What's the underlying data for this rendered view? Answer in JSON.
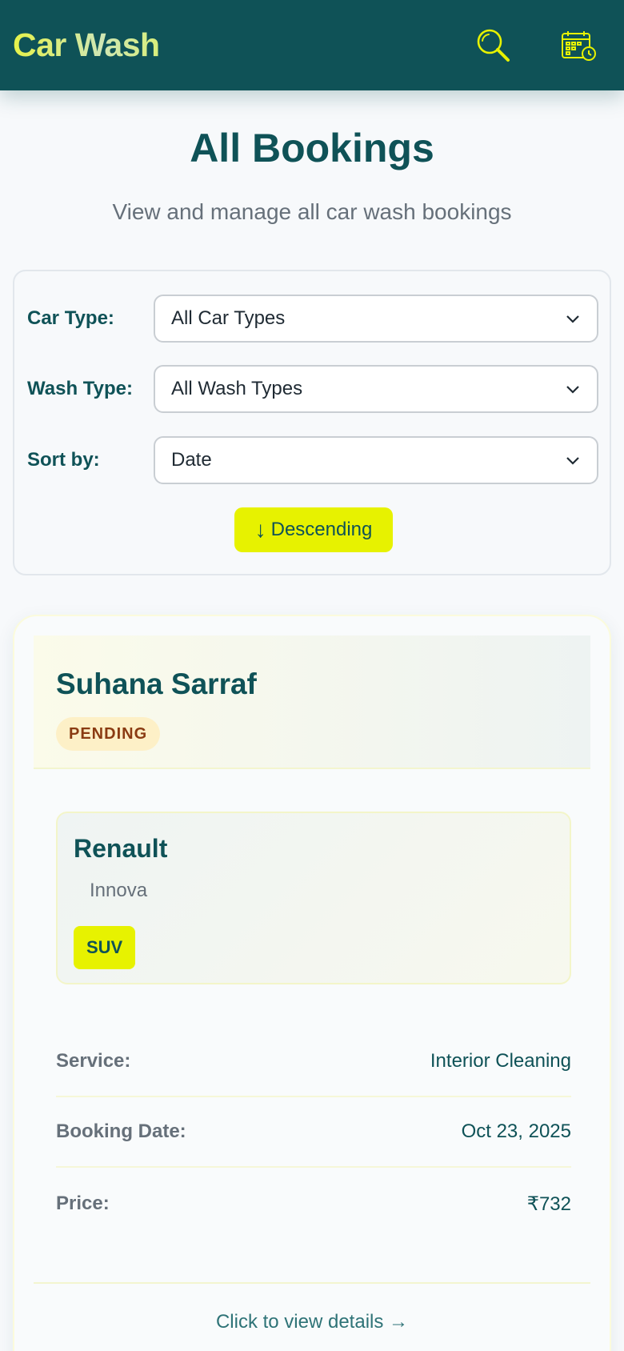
{
  "header": {
    "brand": "Car Wash",
    "search_icon": "search-icon",
    "calendar_icon": "calendar-clock-icon"
  },
  "page": {
    "title": "All Bookings",
    "subtitle": "View and manage all car wash bookings"
  },
  "filters": {
    "car_type": {
      "label": "Car Type:",
      "value": "All Car Types"
    },
    "wash_type": {
      "label": "Wash Type:",
      "value": "All Wash Types"
    },
    "sort_by": {
      "label": "Sort by:",
      "value": "Date"
    },
    "order_button": {
      "arrow": "↓",
      "label": "Descending"
    }
  },
  "booking": {
    "customer": "Suhana Sarraf",
    "status": "PENDING",
    "car": {
      "make": "Renault",
      "model": "Innova",
      "type": "SUV"
    },
    "details": [
      {
        "label": "Service:",
        "value": "Interior Cleaning"
      },
      {
        "label": "Booking Date:",
        "value": "Oct 23, 2025"
      },
      {
        "label": "Price:",
        "value": "₹732"
      }
    ],
    "view_link": "Click to view details →"
  },
  "colors": {
    "primary": "#0f5257",
    "accent": "#e7f200",
    "status_pending_bg": "#fdf0c7",
    "status_pending_text": "#8a3b12"
  }
}
